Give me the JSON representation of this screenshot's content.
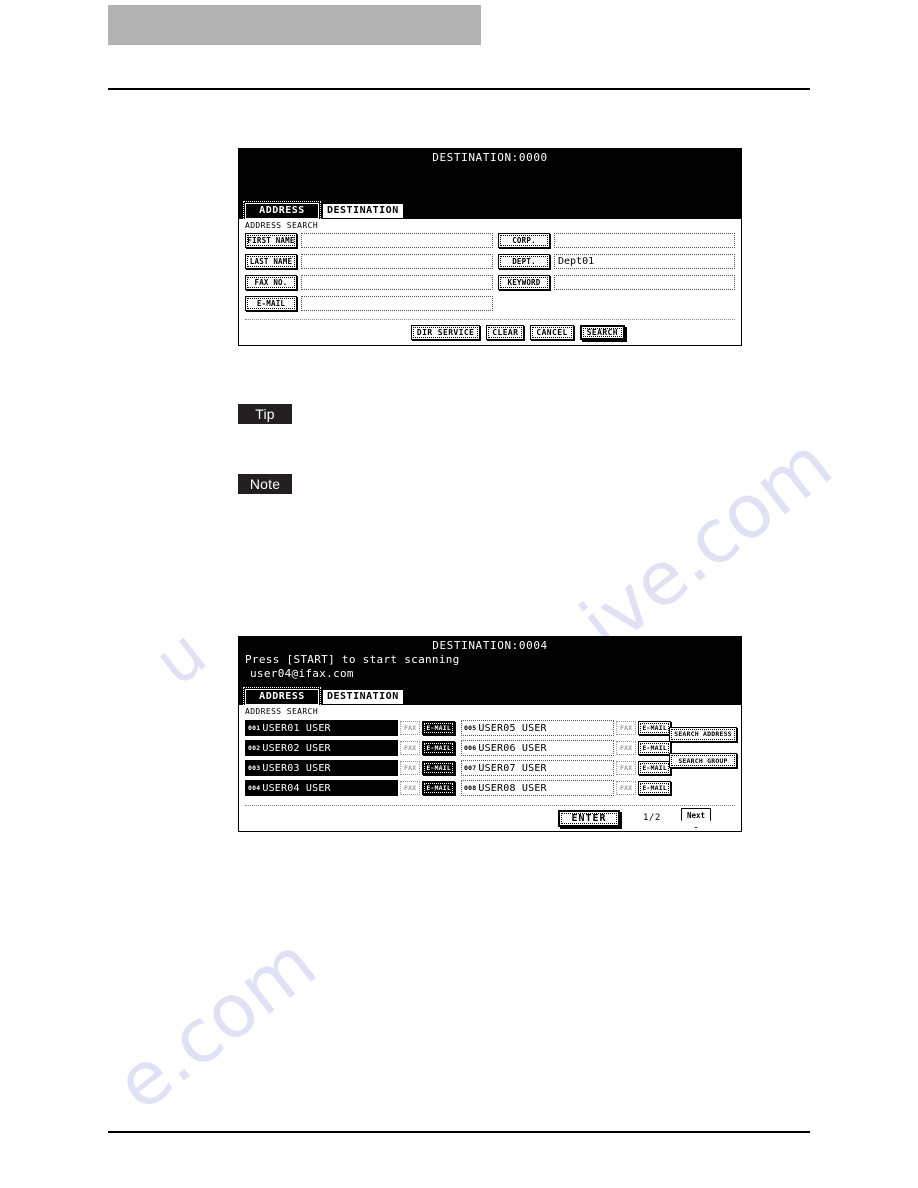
{
  "page": {
    "header_bar_visible": true,
    "rules_visible": true,
    "watermark": [
      "ive.com",
      "e.com",
      "u"
    ]
  },
  "callouts": {
    "tip_label": "Tip",
    "note_label": "Note"
  },
  "panel_search": {
    "destination_counter": "DESTINATION:0000",
    "tabs": [
      {
        "label": "ADDRESS",
        "active": true
      },
      {
        "label": "DESTINATION",
        "active": false
      }
    ],
    "section_title": "ADDRESS SEARCH",
    "fields_left": [
      {
        "label": "FIRST NAME",
        "value": ""
      },
      {
        "label": "LAST NAME",
        "value": ""
      },
      {
        "label": "FAX NO.",
        "value": ""
      },
      {
        "label": "E-MAIL",
        "value": ""
      }
    ],
    "fields_right": [
      {
        "label": "CORP.",
        "value": ""
      },
      {
        "label": "DEPT.",
        "value": "Dept01"
      },
      {
        "label": "KEYWORD",
        "value": ""
      }
    ],
    "buttons": [
      {
        "label": "DIR SERVICE",
        "emphasis": false
      },
      {
        "label": "CLEAR",
        "emphasis": false
      },
      {
        "label": "CANCEL",
        "emphasis": false
      },
      {
        "label": "SEARCH",
        "emphasis": true
      }
    ]
  },
  "panel_results": {
    "destination_counter": "DESTINATION:0004",
    "message_line1": "Press [START] to start scanning",
    "message_line2": "user04@ifax.com",
    "tabs": [
      {
        "label": "ADDRESS",
        "active": true
      },
      {
        "label": "DESTINATION",
        "active": false
      }
    ],
    "section_title": "ADDRESS SEARCH",
    "column_left": [
      {
        "num": "001",
        "name": "USER01 USER",
        "fax": "FAX",
        "mail": "E-MAIL",
        "selected": true
      },
      {
        "num": "002",
        "name": "USER02 USER",
        "fax": "FAX",
        "mail": "E-MAIL",
        "selected": true
      },
      {
        "num": "003",
        "name": "USER03 USER",
        "fax": "FAX",
        "mail": "E-MAIL",
        "selected": true
      },
      {
        "num": "004",
        "name": "USER04 USER",
        "fax": "FAX",
        "mail": "E-MAIL",
        "selected": true
      }
    ],
    "column_right": [
      {
        "num": "005",
        "name": "USER05 USER",
        "fax": "FAX",
        "mail": "E-MAIL",
        "selected": false
      },
      {
        "num": "006",
        "name": "USER06 USER",
        "fax": "FAX",
        "mail": "E-MAIL",
        "selected": false
      },
      {
        "num": "007",
        "name": "USER07 USER",
        "fax": "FAX",
        "mail": "E-MAIL",
        "selected": false
      },
      {
        "num": "008",
        "name": "USER08 USER",
        "fax": "FAX",
        "mail": "E-MAIL",
        "selected": false
      }
    ],
    "side_buttons": [
      {
        "label": "SEARCH ADDRESS"
      },
      {
        "label": "SEARCH GROUP"
      }
    ],
    "enter_label": "ENTER",
    "page_indicator": "1/2",
    "next_label": "Next"
  }
}
